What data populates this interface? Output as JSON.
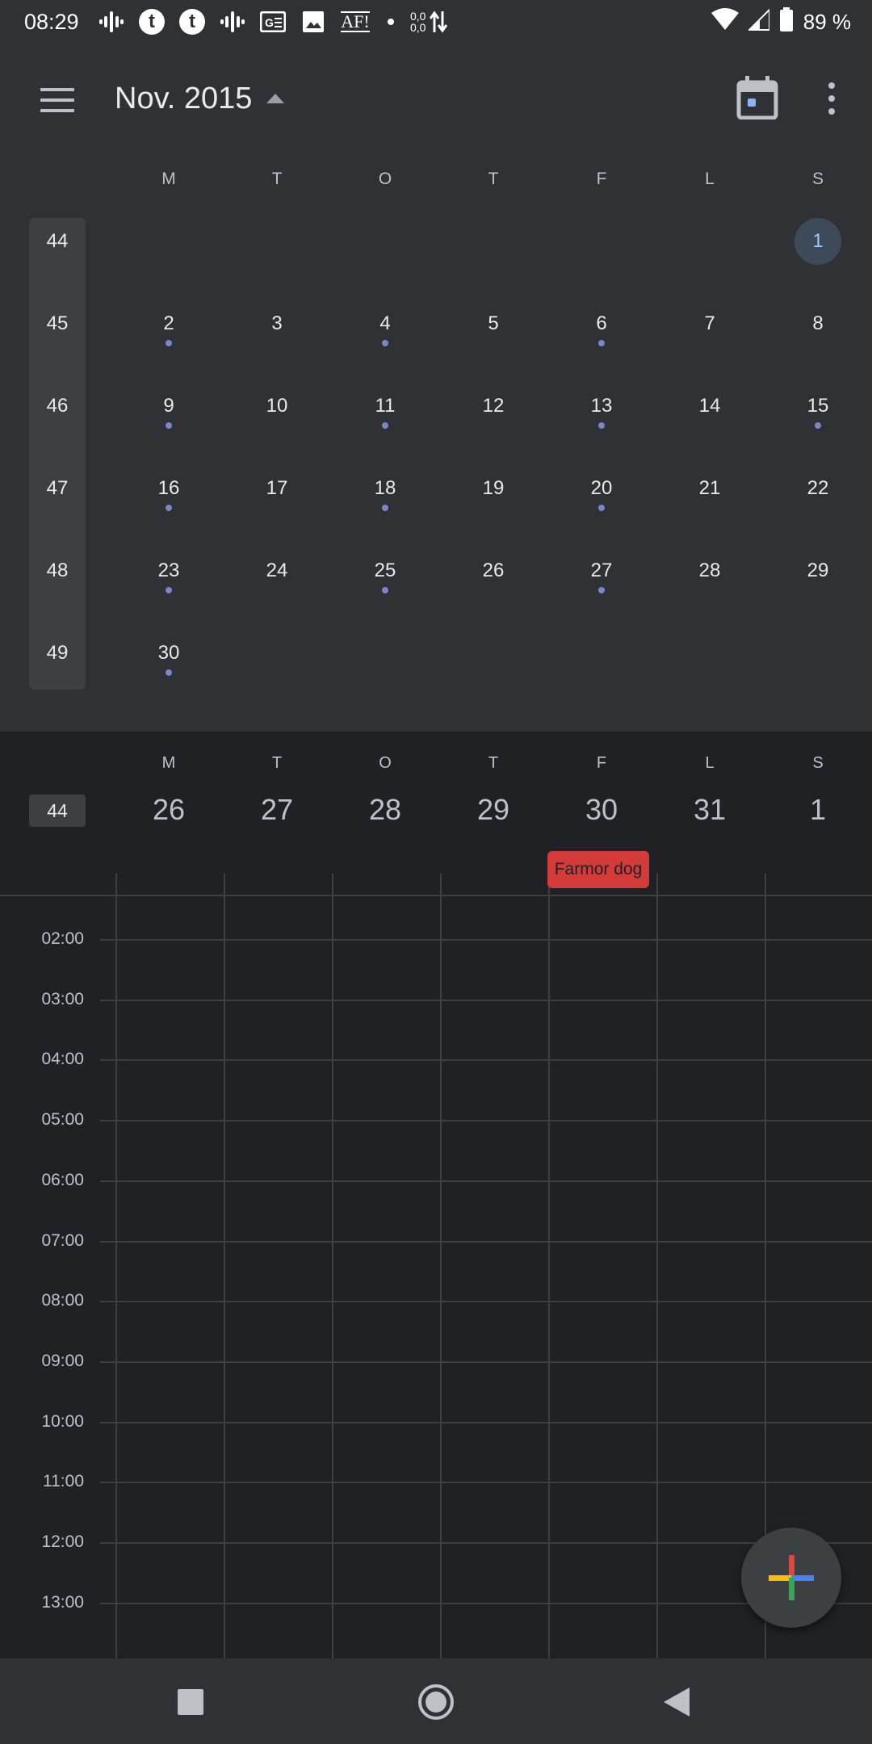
{
  "status_bar": {
    "time": "08:29",
    "af_label": "AF!",
    "data_up": "0,0",
    "data_down": "0,0",
    "battery": "89 %"
  },
  "header": {
    "month_title": "Nov. 2015"
  },
  "month_view": {
    "weekday_labels": [
      "M",
      "T",
      "O",
      "T",
      "F",
      "L",
      "S"
    ],
    "week_numbers": [
      "44",
      "45",
      "46",
      "47",
      "48",
      "49"
    ],
    "selected_day": "1",
    "weeks": [
      [
        "",
        "",
        "",
        "",
        "",
        "",
        "1"
      ],
      [
        "2",
        "3",
        "4",
        "5",
        "6",
        "7",
        "8"
      ],
      [
        "9",
        "10",
        "11",
        "12",
        "13",
        "14",
        "15"
      ],
      [
        "16",
        "17",
        "18",
        "19",
        "20",
        "21",
        "22"
      ],
      [
        "23",
        "24",
        "25",
        "26",
        "27",
        "28",
        "29"
      ],
      [
        "30",
        "",
        "",
        "",
        "",
        "",
        ""
      ]
    ],
    "event_dots": [
      [
        0,
        0,
        0,
        0,
        0,
        0,
        0
      ],
      [
        1,
        0,
        1,
        0,
        1,
        0,
        0
      ],
      [
        1,
        0,
        1,
        0,
        1,
        0,
        1
      ],
      [
        1,
        0,
        1,
        0,
        1,
        0,
        0
      ],
      [
        1,
        0,
        1,
        0,
        1,
        0,
        0
      ],
      [
        1,
        0,
        0,
        0,
        0,
        0,
        0
      ]
    ]
  },
  "week_view": {
    "week_number": "44",
    "weekday_labels": [
      "M",
      "T",
      "O",
      "T",
      "F",
      "L",
      "S"
    ],
    "dates": [
      "26",
      "27",
      "28",
      "29",
      "30",
      "31",
      "1"
    ],
    "event": {
      "title": "Farmor dog",
      "day_index": 4,
      "color": "#d33b3b"
    },
    "hours": [
      "02:00",
      "03:00",
      "04:00",
      "05:00",
      "06:00",
      "07:00",
      "08:00",
      "09:00",
      "10:00",
      "11:00",
      "12:00",
      "13:00"
    ]
  },
  "colors": {
    "header_bg": "#303134",
    "body_bg": "#202124",
    "event_dot": "#7986cb",
    "event_red": "#d33b3b",
    "today_circle": "#3c4a5a"
  },
  "icons": {
    "menu": "hamburger-menu-icon",
    "today": "calendar-today-icon",
    "more": "more-vert-icon",
    "fab": "plus-icon"
  }
}
